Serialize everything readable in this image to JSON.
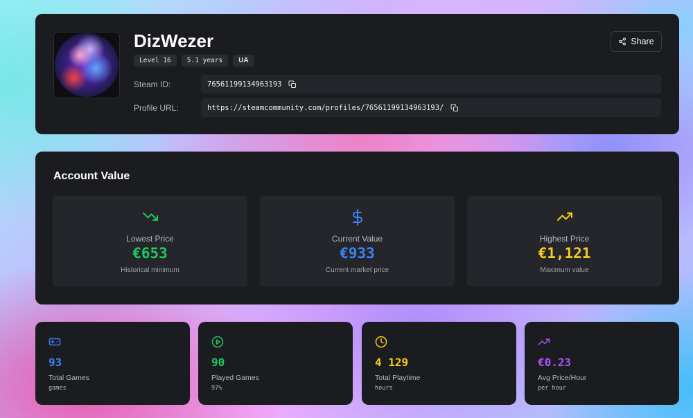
{
  "profile": {
    "name": "DizWezer",
    "badges": [
      "Level 16",
      "5.1 years",
      "UA"
    ],
    "share_label": "Share",
    "steam_id_label": "Steam ID:",
    "steam_id": "76561199134963193",
    "profile_url_label": "Profile URL:",
    "profile_url": "https://steamcommunity.com/profiles/76561199134963193/"
  },
  "account_value": {
    "title": "Account Value",
    "cards": [
      {
        "label": "Lowest Price",
        "amount": "€653",
        "sub": "Historical minimum",
        "icon": "trending-down-icon",
        "color": "#22c55e"
      },
      {
        "label": "Current Value",
        "amount": "€933",
        "sub": "Current market price",
        "icon": "dollar-sign-icon",
        "color": "#3b82f6"
      },
      {
        "label": "Highest Price",
        "amount": "€1,121",
        "sub": "Maximum value",
        "icon": "trending-up-icon",
        "color": "#facc15"
      }
    ]
  },
  "stats": [
    {
      "value": "93",
      "label": "Total Games",
      "sub": "games",
      "icon": "gamepad-icon",
      "color": "#3b82f6"
    },
    {
      "value": "90",
      "label": "Played Games",
      "sub": "97%",
      "icon": "play-circle-icon",
      "color": "#22c55e"
    },
    {
      "value": "4 129",
      "label": "Total Playtime",
      "sub": "hours",
      "icon": "clock-icon",
      "color": "#facc15"
    },
    {
      "value": "€0.23",
      "label": "Avg Price/Hour",
      "sub": "per hour",
      "icon": "trending-up-icon",
      "color": "#a855f7"
    }
  ]
}
